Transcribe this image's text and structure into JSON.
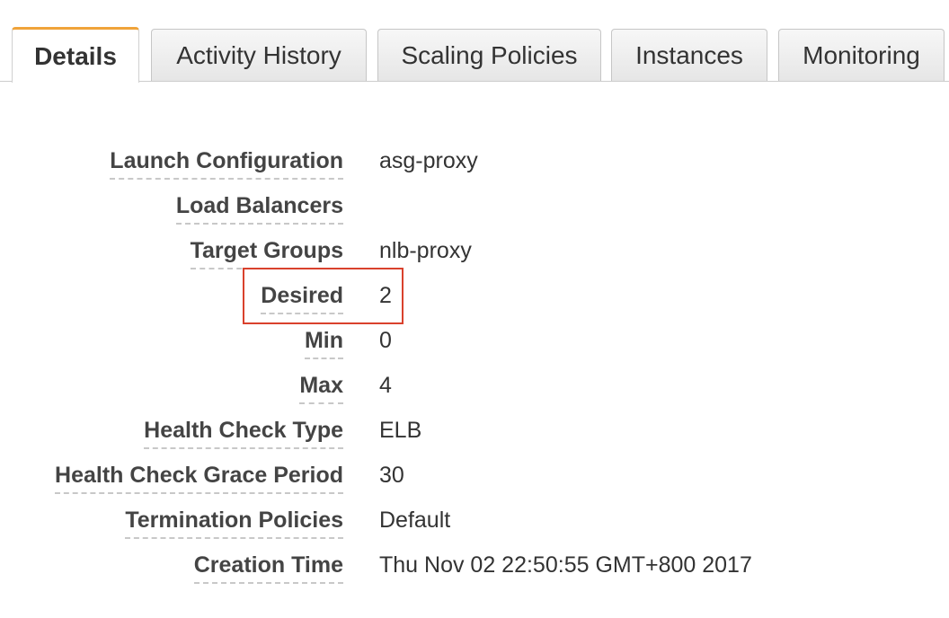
{
  "tabs": [
    {
      "label": "Details",
      "active": true
    },
    {
      "label": "Activity History",
      "active": false
    },
    {
      "label": "Scaling Policies",
      "active": false
    },
    {
      "label": "Instances",
      "active": false
    },
    {
      "label": "Monitoring",
      "active": false
    }
  ],
  "details": [
    {
      "label": "Launch Configuration",
      "value": "asg-proxy"
    },
    {
      "label": "Load Balancers",
      "value": ""
    },
    {
      "label": "Target Groups",
      "value": "nlb-proxy"
    },
    {
      "label": "Desired",
      "value": "2"
    },
    {
      "label": "Min",
      "value": "0"
    },
    {
      "label": "Max",
      "value": "4"
    },
    {
      "label": "Health Check Type",
      "value": "ELB"
    },
    {
      "label": "Health Check Grace Period",
      "value": "30"
    },
    {
      "label": "Termination Policies",
      "value": "Default"
    },
    {
      "label": "Creation Time",
      "value": "Thu Nov 02 22:50:55 GMT+800 2017"
    }
  ],
  "colors": {
    "active_tab_accent": "#f0a33a",
    "highlight_border": "#d9412d"
  }
}
